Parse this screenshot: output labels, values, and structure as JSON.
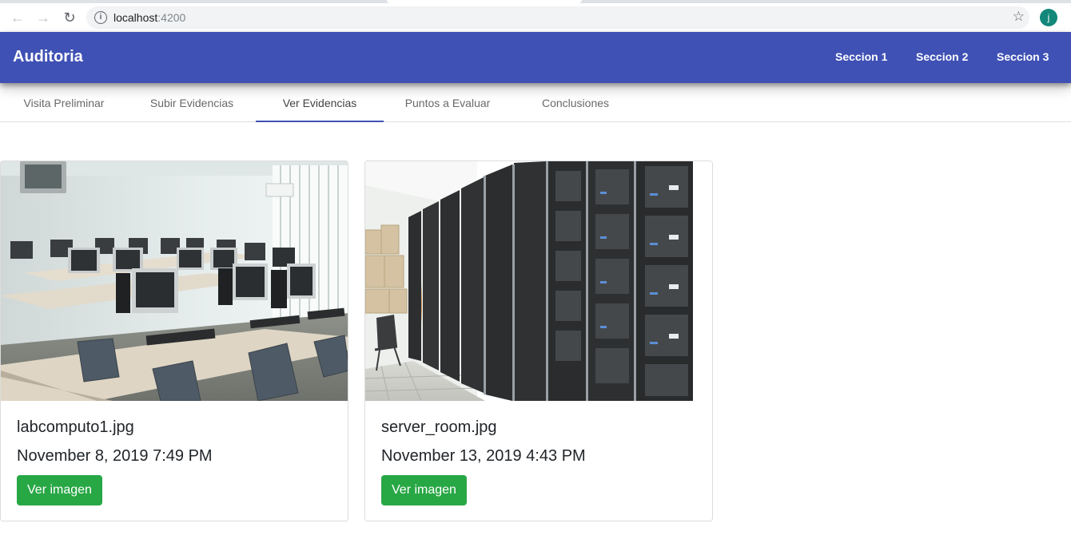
{
  "browser": {
    "url_host": "localhost",
    "url_port": ":4200",
    "avatar_letter": "j"
  },
  "toolbar": {
    "title": "Auditoria",
    "links": [
      "Seccion 1",
      "Seccion 2",
      "Seccion 3"
    ]
  },
  "tabs": {
    "items": [
      "Visita Preliminar",
      "Subir Evidencias",
      "Ver Evidencias",
      "Puntos a Evaluar",
      "Conclusiones"
    ],
    "active": "Ver Evidencias"
  },
  "cards": [
    {
      "filename": "labcomputo1.jpg",
      "date": "November 8, 2019 7:49 PM",
      "button": "Ver imagen",
      "image": "computer-lab-photo"
    },
    {
      "filename": "server_room.jpg",
      "date": "November 13, 2019 4:43 PM",
      "button": "Ver imagen",
      "image": "server-room-photo"
    }
  ],
  "colors": {
    "primary": "#3f51b5",
    "success": "#28a745"
  }
}
